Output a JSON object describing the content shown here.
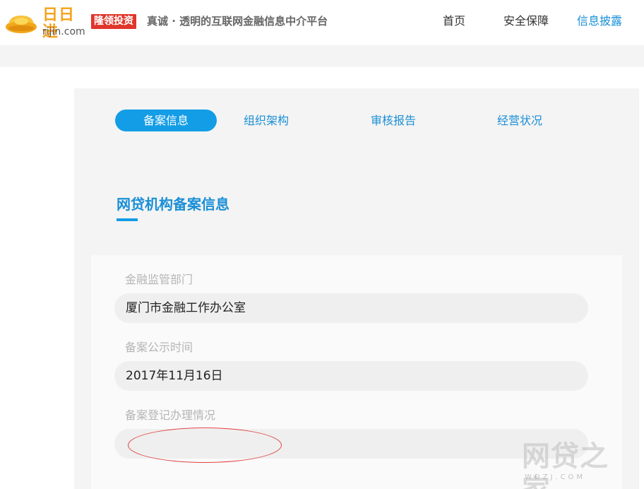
{
  "header": {
    "logo_cn": "日日进",
    "logo_en": "rijin.com",
    "badge": "隆领投资",
    "slogan": "真诚 · 透明的互联网金融信息中介平台",
    "nav": [
      {
        "label": "首页",
        "active": false
      },
      {
        "label": "安全保障",
        "active": false
      },
      {
        "label": "信息披露",
        "active": true
      }
    ]
  },
  "tabs": [
    {
      "label": "备案信息",
      "active": true
    },
    {
      "label": "组织架构",
      "active": false
    },
    {
      "label": "审核报告",
      "active": false
    },
    {
      "label": "经营状况",
      "active": false
    }
  ],
  "section": {
    "title": "网贷机构备案信息"
  },
  "fields": [
    {
      "label": "金融监管部门",
      "value": "厦门市金融工作办公室"
    },
    {
      "label": "备案公示时间",
      "value": "2017年11月16日"
    },
    {
      "label": "备案登记办理情况",
      "value": ""
    }
  ],
  "watermark": {
    "text": "网贷之家",
    "url": "WDZJ.COM"
  },
  "colors": {
    "accent": "#139de6",
    "link": "#1a8fd6",
    "brand_orange": "#f5a21b",
    "badge_red": "#e0352b",
    "annotation_red": "#e04040"
  }
}
